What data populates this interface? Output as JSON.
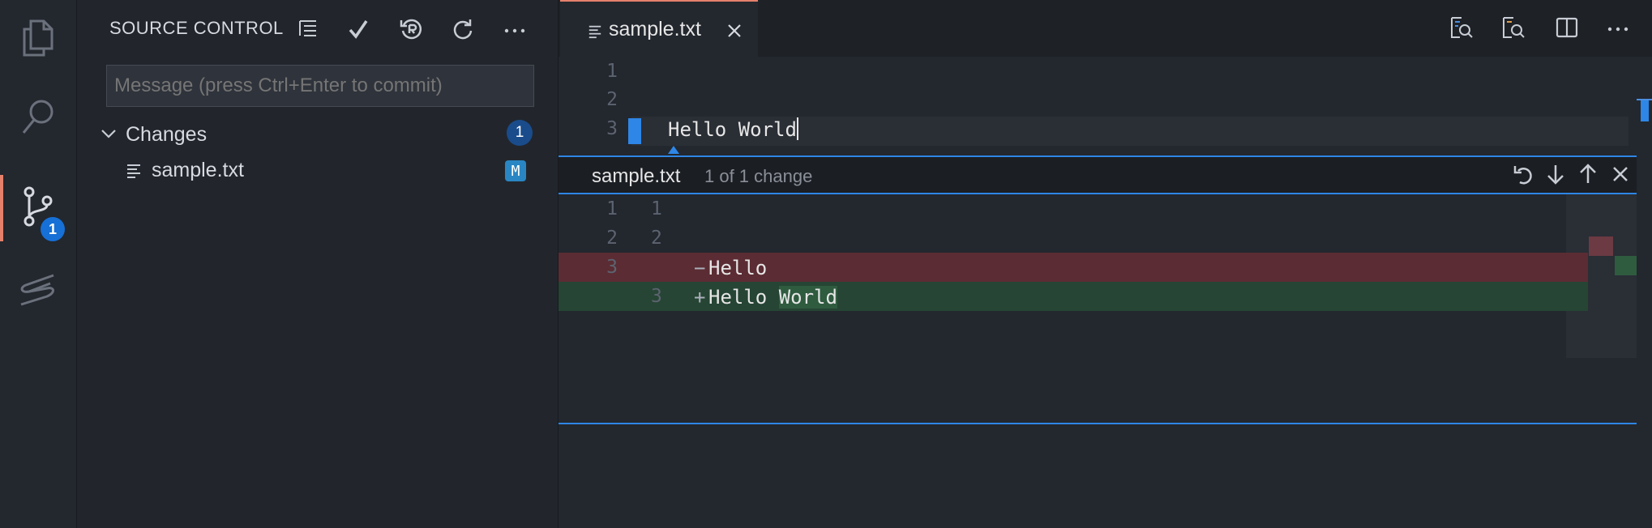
{
  "activity_bar": {
    "items": [
      {
        "name": "explorer",
        "icon": "files-icon"
      },
      {
        "name": "search",
        "icon": "search-icon"
      },
      {
        "name": "source-control",
        "icon": "source-control-icon",
        "badge": "1",
        "active": true
      },
      {
        "name": "extension",
        "icon": "stylus-icon"
      }
    ]
  },
  "sidebar": {
    "title": "SOURCE CONTROL",
    "message_placeholder": "Message (press Ctrl+Enter to commit)",
    "changes_label": "Changes",
    "changes_count": "1",
    "files": [
      {
        "name": "sample.txt",
        "status": "M"
      }
    ]
  },
  "editor": {
    "tab_label": "sample.txt",
    "lines": [
      {
        "number": "1",
        "text": ""
      },
      {
        "number": "2",
        "text": ""
      },
      {
        "number": "3",
        "text": "Hello World"
      }
    ]
  },
  "peek": {
    "title": "sample.txt",
    "subtitle": "1 of 1 change",
    "diff": [
      {
        "old": "1",
        "new": "1",
        "mark": "",
        "text": ""
      },
      {
        "old": "2",
        "new": "2",
        "mark": "",
        "text": ""
      },
      {
        "old": "3",
        "new": "",
        "mark": "−",
        "text": "Hello",
        "kind": "removed"
      },
      {
        "old": "",
        "new": "3",
        "mark": "+",
        "text_plain": "Hello ",
        "text_added": "World",
        "kind": "added"
      }
    ]
  },
  "colors": {
    "accent": "#e5816b",
    "badge": "#1670d6",
    "modified": "#2a86c3",
    "peek_border": "#2e86e6",
    "removed_bg": "#5b2c33",
    "added_bg": "#264534"
  }
}
